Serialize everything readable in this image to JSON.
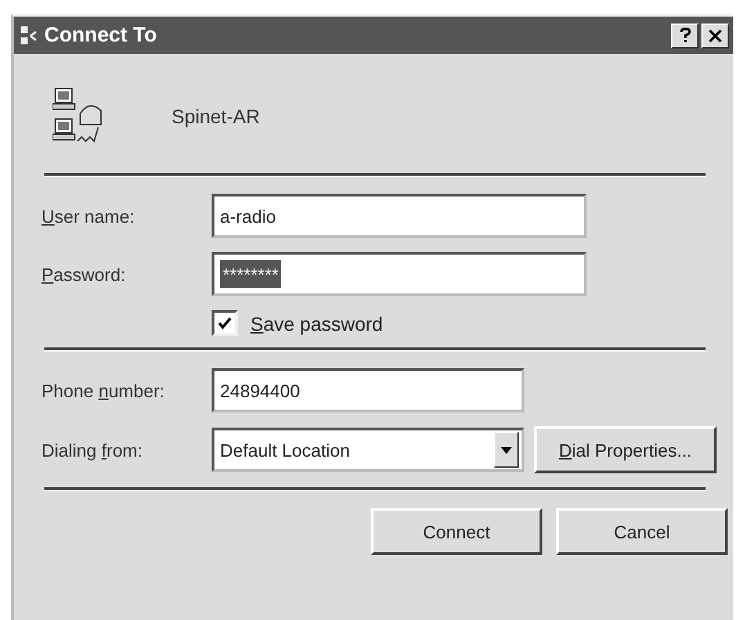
{
  "window": {
    "title": "Connect To"
  },
  "connection": {
    "name": "Spinet-AR"
  },
  "credentials": [
    {
      "access_key": "U",
      "label_end": "ser name:",
      "value": "a-radio",
      "selected": false
    },
    {
      "access_key": "P",
      "label_end": "assword:",
      "value": "********",
      "selected": true
    }
  ],
  "save_password": {
    "access_key": "S",
    "label_end": "ave password",
    "checked": true
  },
  "phone": {
    "label_start": "Phone ",
    "access_key": "n",
    "label_end": "umber:",
    "value": "24894400"
  },
  "dialing": {
    "label_start": "Dialing ",
    "access_key": "f",
    "label_end": "rom:",
    "value": "Default Location"
  },
  "dial_properties": {
    "access_key": "D",
    "label_end": "ial Properties..."
  },
  "buttons": [
    "Connect",
    "Cancel"
  ]
}
